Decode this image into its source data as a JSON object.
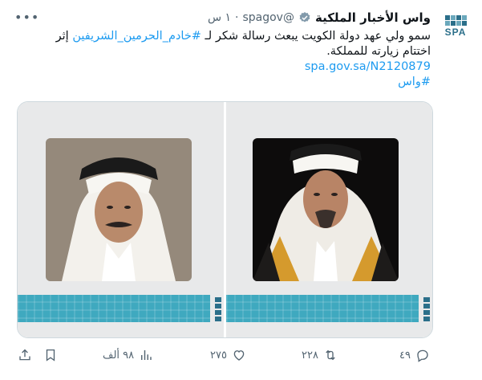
{
  "account": {
    "name": "واس الأخبار الملكية",
    "handle": "@spagov",
    "separator": "·",
    "time": "١ س",
    "avatar_text": "SPA"
  },
  "tweet": {
    "line1_prefix": "سمو ولي عهد دولة الكويت يبعث رسالة شكر لـ",
    "line1_hashtag": "#خادم_الحرمين_الشريفين",
    "line1_suffix": "إثر",
    "line2": "اختتام زيارته للمملكة.",
    "link": "spa.gov.sa/N2120879",
    "hashtag2": "#واس"
  },
  "media": {
    "left_image": "photo-kuwait-crown-prince",
    "right_image": "photo-king-salman"
  },
  "actions": {
    "replies": "٤٩",
    "retweets": "٢٢٨",
    "likes": "٢٧٥",
    "views": "٩٨ ألف"
  },
  "icons": {
    "verified": "verified-badge-icon",
    "more": "more-options-icon",
    "reply": "reply-icon",
    "retweet": "retweet-icon",
    "like": "heart-icon",
    "views": "views-icon",
    "bookmark": "bookmark-icon",
    "share": "share-icon"
  },
  "colors": {
    "link": "#1d9bf0",
    "muted": "#536471",
    "brand": "#3fa9bf"
  }
}
